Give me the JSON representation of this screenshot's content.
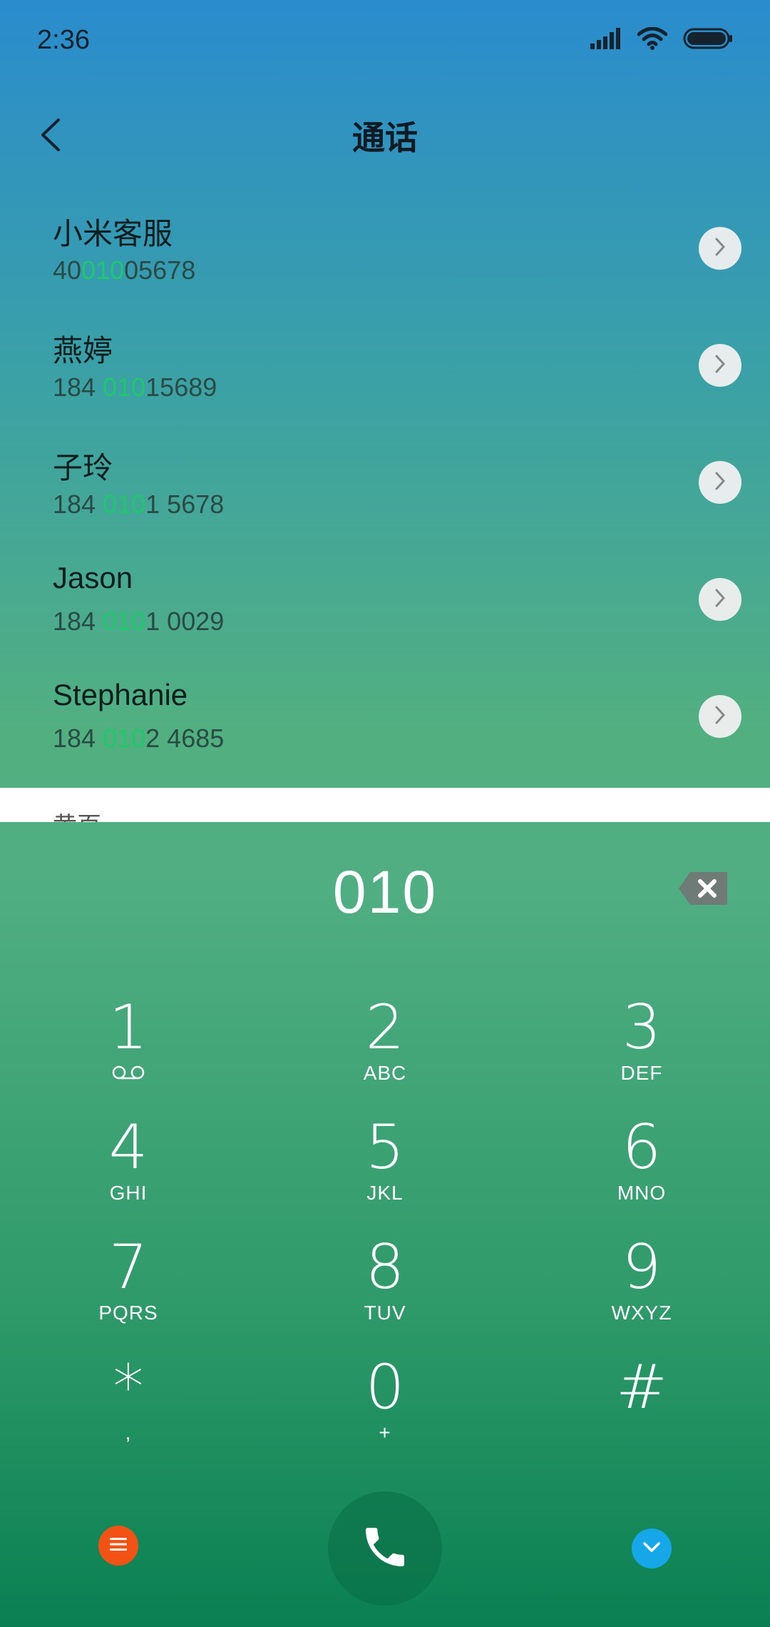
{
  "status": {
    "time": "2:36"
  },
  "header": {
    "title": "通话"
  },
  "contacts": [
    {
      "name": "小米客服",
      "num_pre": "40",
      "num_hl": "010",
      "num_post": "05678"
    },
    {
      "name": "燕婷",
      "num_pre": "184 ",
      "num_hl": "010",
      "num_post": "15689"
    },
    {
      "name": "子玲",
      "num_pre": "184 ",
      "num_hl": "010",
      "num_post": "1 5678"
    },
    {
      "name": "Jason",
      "num_pre": "184 ",
      "num_hl": "010",
      "num_post": "1 0029"
    },
    {
      "name": "Stephanie",
      "num_pre": "184 ",
      "num_hl": "010",
      "num_post": "2 4685"
    }
  ],
  "section": {
    "label": "黄页"
  },
  "dialer": {
    "entered": "010",
    "keys": [
      {
        "digit": "1",
        "letters": ""
      },
      {
        "digit": "2",
        "letters": "ABC"
      },
      {
        "digit": "3",
        "letters": "DEF"
      },
      {
        "digit": "4",
        "letters": "GHI"
      },
      {
        "digit": "5",
        "letters": "JKL"
      },
      {
        "digit": "6",
        "letters": "MNO"
      },
      {
        "digit": "7",
        "letters": "PQRS"
      },
      {
        "digit": "8",
        "letters": "TUV"
      },
      {
        "digit": "9",
        "letters": "WXYZ"
      },
      {
        "digit": "*",
        "letters": ","
      },
      {
        "digit": "0",
        "letters": "+"
      },
      {
        "digit": "#",
        "letters": ""
      }
    ]
  },
  "icons": {
    "signal": "signal-icon",
    "wifi": "wifi-icon",
    "battery": "battery-icon",
    "back": "back-icon",
    "detail": "chevron-right-icon",
    "backspace": "backspace-icon",
    "voicemail": "voicemail-icon",
    "menu": "menu-icon",
    "call": "phone-icon",
    "collapse": "chevron-down-icon"
  },
  "colors": {
    "highlight": "#1ec86b",
    "menu_button": "#f25314",
    "collapse_button": "#15a7e8"
  }
}
